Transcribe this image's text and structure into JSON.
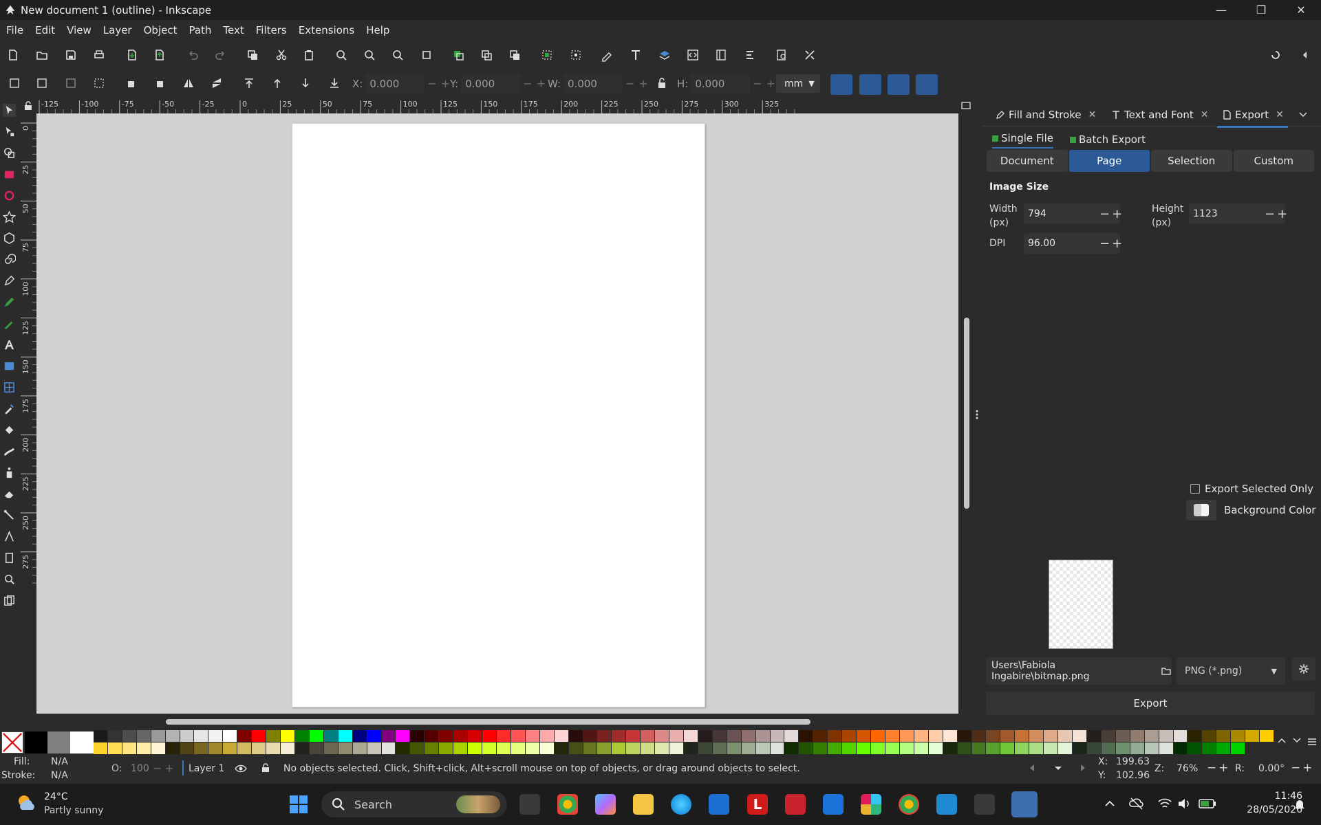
{
  "window": {
    "title": "New document 1 (outline) - Inkscape",
    "controls": [
      "minimize",
      "restore",
      "close"
    ]
  },
  "menu": [
    "File",
    "Edit",
    "View",
    "Layer",
    "Object",
    "Path",
    "Text",
    "Filters",
    "Extensions",
    "Help"
  ],
  "controls_bar": {
    "x_label": "X:",
    "x_value": "0.000",
    "y_label": "Y:",
    "y_value": "0.000",
    "w_label": "W:",
    "w_value": "0.000",
    "h_label": "H:",
    "h_value": "0.000",
    "unit": "mm"
  },
  "ruler": {
    "h_ticks": [
      "-125",
      "-100",
      "-75",
      "-50",
      "-25",
      "0",
      "25",
      "50",
      "75",
      "100",
      "125",
      "150",
      "175",
      "200",
      "225",
      "250",
      "275",
      "300",
      "325"
    ],
    "v_ticks": [
      "0",
      "25",
      "50",
      "75",
      "100",
      "125",
      "150",
      "175",
      "200",
      "225",
      "250",
      "275"
    ]
  },
  "panel": {
    "tabs": [
      {
        "label": "Fill and Stroke",
        "icon": "pen-icon"
      },
      {
        "label": "Text and Font",
        "icon": "text-icon"
      },
      {
        "label": "Export",
        "icon": "document-icon"
      }
    ],
    "active_tab": "Export",
    "subtabs": [
      "Single File",
      "Batch Export"
    ],
    "area_buttons": [
      "Document",
      "Page",
      "Selection",
      "Custom"
    ],
    "active_area": "Page",
    "image_size_title": "Image Size",
    "width_label": "Width\n(px)",
    "width_label_1": "Width",
    "width_label_2": "(px)",
    "width_value": "794",
    "height_label_1": "Height",
    "height_label_2": "(px)",
    "height_value": "1123",
    "dpi_label": "DPI",
    "dpi_value": "96.00",
    "export_selected_only": "Export Selected Only",
    "export_selected_checked": false,
    "background_color": "Background Color",
    "file_path": "Users\\Fabiola Ingabire\\bitmap.png",
    "format": "PNG (*.png)",
    "export_button": "Export"
  },
  "status": {
    "fill_label": "Fill:",
    "fill_value": "N/A",
    "stroke_label": "Stroke:",
    "stroke_value": "N/A",
    "opacity_label": "O:",
    "opacity_value": "100",
    "layer": "Layer 1",
    "message": "No objects selected. Click, Shift+click, Alt+scroll mouse on top of objects, or drag around objects to select.",
    "x_label": "X:",
    "x_value": "199.63",
    "y_label": "Y:",
    "y_value": "102.96",
    "zoom_label": "Z:",
    "zoom_value": "76%",
    "rotation_label": "R:",
    "rotation_value": "0.00°"
  },
  "taskbar": {
    "weather_temp": "24°C",
    "weather_desc": "Partly sunny",
    "search_label": "Search",
    "time": "11:46",
    "date": "28/05/2026"
  },
  "colors": {
    "accent": "#2c5a96",
    "canvas": "#d1d1d1",
    "background": "#2b2b2b"
  }
}
